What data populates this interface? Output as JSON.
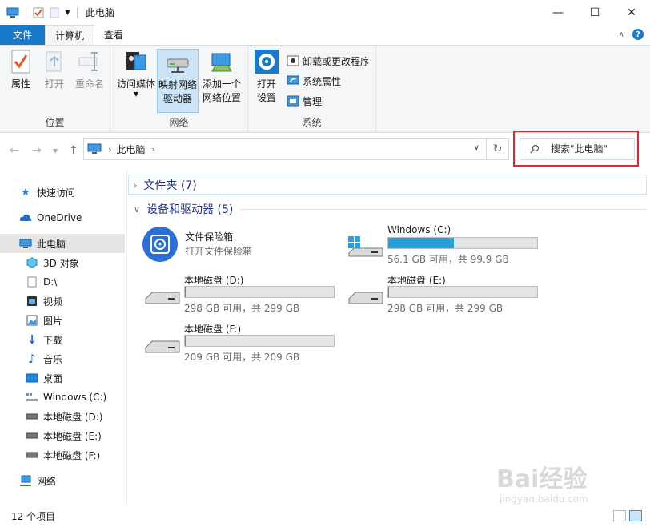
{
  "window": {
    "title": "此电脑"
  },
  "ribbon_tabs": {
    "file": "文件",
    "computer": "计算机",
    "view": "查看"
  },
  "ribbon": {
    "location": {
      "label": "位置",
      "properties": "属性",
      "open": "打开",
      "rename": "重命名"
    },
    "network": {
      "label": "网络",
      "access_media": "访问媒体",
      "map_drive_1": "映射网络",
      "map_drive_2": "驱动器",
      "add_location_1": "添加一个",
      "add_location_2": "网络位置"
    },
    "system": {
      "label": "系统",
      "open_settings_1": "打开",
      "open_settings_2": "设置",
      "uninstall": "卸载或更改程序",
      "system_props": "系统属性",
      "manage": "管理"
    }
  },
  "address": {
    "crumb": "此电脑",
    "search_placeholder": "搜索\"此电脑\""
  },
  "nav_pane": {
    "items": [
      {
        "label": "快速访问"
      },
      {
        "label": "OneDrive"
      },
      {
        "label": "此电脑"
      },
      {
        "label": "3D 对象"
      },
      {
        "label": "D:\\"
      },
      {
        "label": "视频"
      },
      {
        "label": "图片"
      },
      {
        "label": "下载"
      },
      {
        "label": "音乐"
      },
      {
        "label": "桌面"
      },
      {
        "label": "Windows (C:)"
      },
      {
        "label": "本地磁盘 (D:)"
      },
      {
        "label": "本地磁盘 (E:)"
      },
      {
        "label": "本地磁盘 (F:)"
      },
      {
        "label": "网络"
      }
    ]
  },
  "content": {
    "folders_header": "文件夹 (7)",
    "devices_header": "设备和驱动器 (5)",
    "vault": {
      "title": "文件保险箱",
      "subtitle": "打开文件保险箱"
    },
    "drives": [
      {
        "name": "Windows (C:)",
        "info": "56.1 GB 可用，共 99.9 GB",
        "used_fraction": 0.44
      },
      {
        "name": "本地磁盘 (D:)",
        "info": "298 GB 可用，共 299 GB",
        "used_fraction": 0.005
      },
      {
        "name": "本地磁盘 (E:)",
        "info": "298 GB 可用，共 299 GB",
        "used_fraction": 0.005
      },
      {
        "name": "本地磁盘 (F:)",
        "info": "209 GB 可用，共 209 GB",
        "used_fraction": 0.003
      }
    ]
  },
  "status": {
    "count": "12 个项目"
  },
  "watermark": {
    "brand": "Bai经验",
    "url": "jingyan.baidu.com"
  },
  "colors": {
    "accent": "#1979ca",
    "highlight": "#e5262f",
    "bar_fill": "#26a0da"
  }
}
